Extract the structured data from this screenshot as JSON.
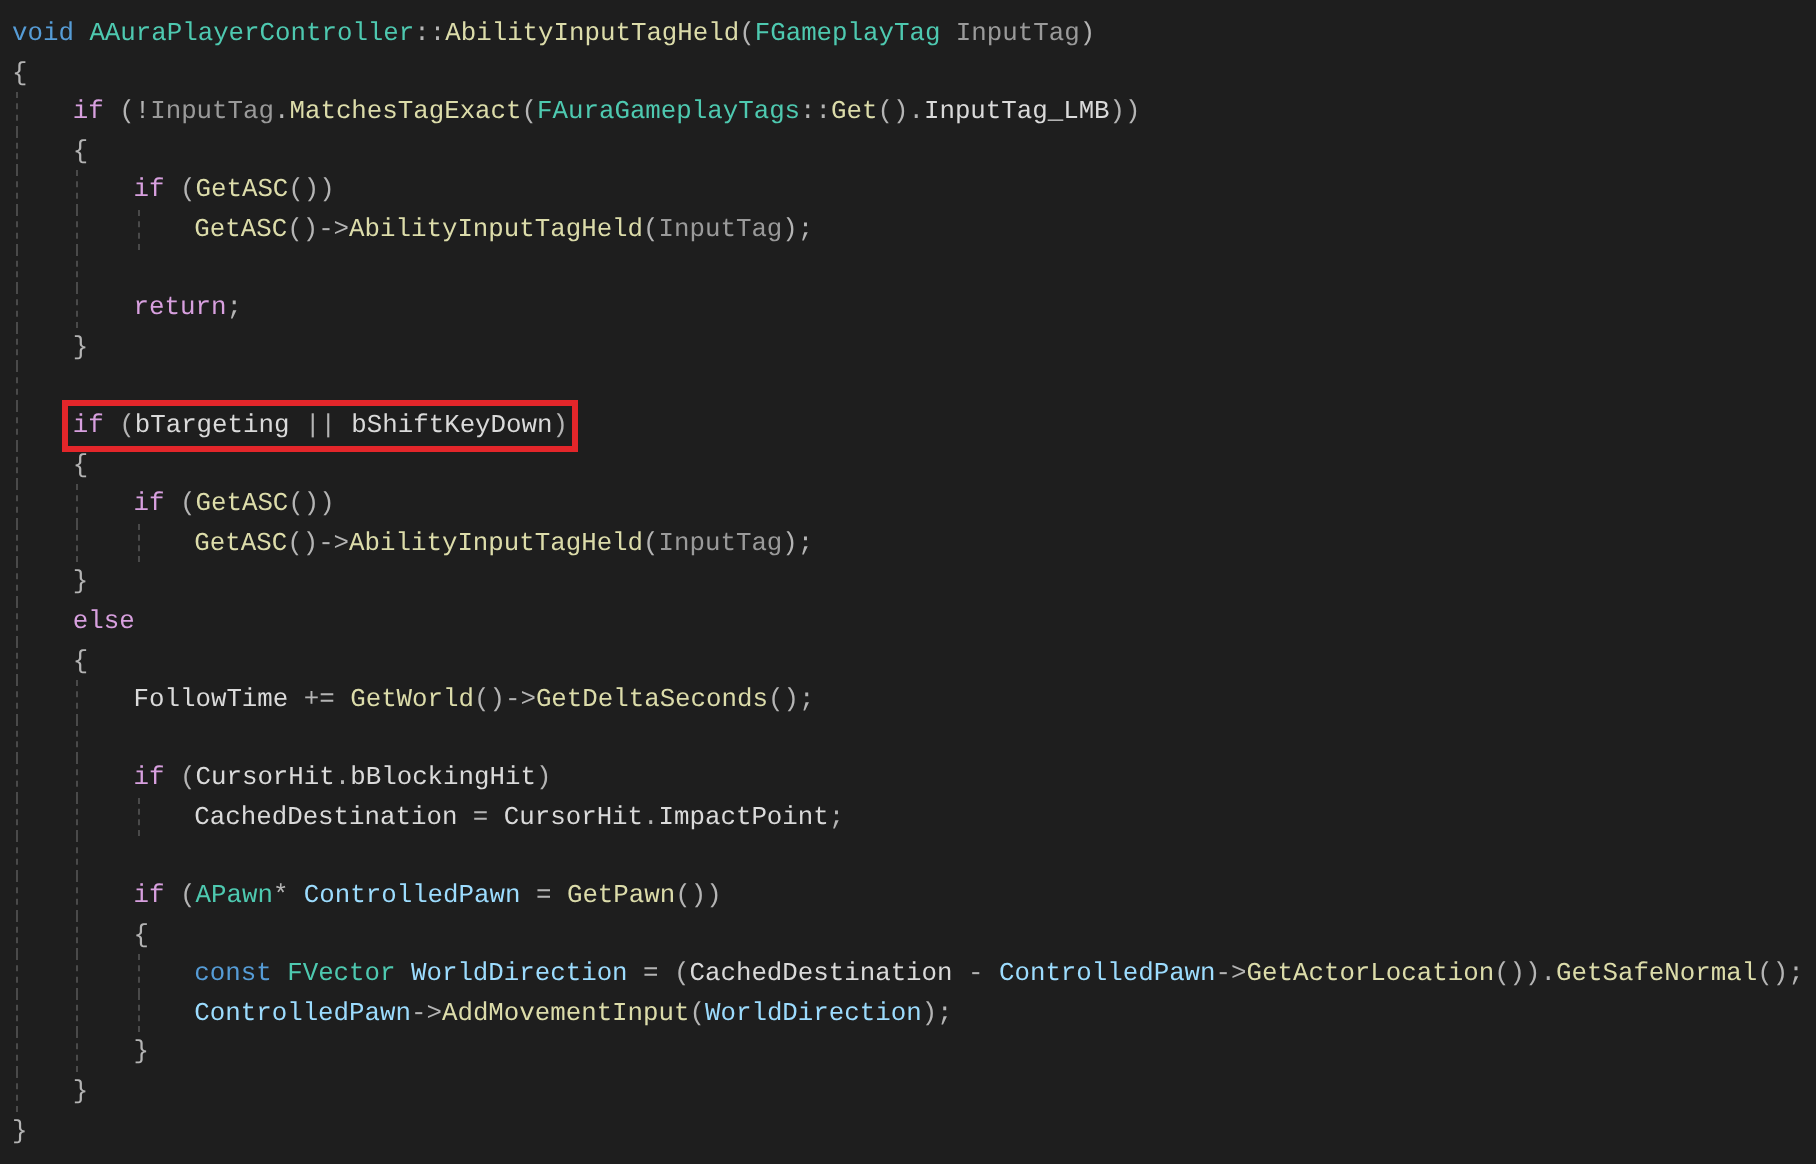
{
  "editor": {
    "code": [
      {
        "kind": "line",
        "boxed": false,
        "tokens": [
          {
            "kind": "kw",
            "text": "void "
          },
          {
            "kind": "type",
            "text": "AAuraPlayerController"
          },
          {
            "kind": "punct",
            "text": "::"
          },
          {
            "kind": "fn",
            "text": "AbilityInputTagHeld"
          },
          {
            "kind": "punct",
            "text": "("
          },
          {
            "kind": "type",
            "text": "FGameplayTag"
          },
          {
            "kind": "param",
            "text": " InputTag"
          },
          {
            "kind": "punct",
            "text": ")"
          }
        ]
      },
      {
        "kind": "line",
        "boxed": false,
        "tokens": [
          {
            "kind": "punct",
            "text": "{"
          }
        ]
      },
      {
        "kind": "block",
        "children": [
          {
            "kind": "line",
            "boxed": false,
            "tokens": [
              {
                "kind": "ctl",
                "text": "if"
              },
              {
                "kind": "punct",
                "text": " (!"
              },
              {
                "kind": "param",
                "text": "InputTag"
              },
              {
                "kind": "punct",
                "text": "."
              },
              {
                "kind": "fn",
                "text": "MatchesTagExact"
              },
              {
                "kind": "punct",
                "text": "("
              },
              {
                "kind": "type",
                "text": "FAuraGameplayTags"
              },
              {
                "kind": "punct",
                "text": "::"
              },
              {
                "kind": "fn",
                "text": "Get"
              },
              {
                "kind": "punct",
                "text": "()."
              },
              {
                "kind": "member",
                "text": "InputTag_LMB"
              },
              {
                "kind": "punct",
                "text": "))"
              }
            ]
          },
          {
            "kind": "line",
            "boxed": false,
            "tokens": [
              {
                "kind": "punct",
                "text": "{"
              }
            ]
          },
          {
            "kind": "block",
            "children": [
              {
                "kind": "line",
                "boxed": false,
                "tokens": [
                  {
                    "kind": "ctl",
                    "text": "if"
                  },
                  {
                    "kind": "punct",
                    "text": " ("
                  },
                  {
                    "kind": "fn",
                    "text": "GetASC"
                  },
                  {
                    "kind": "punct",
                    "text": "())"
                  }
                ]
              },
              {
                "kind": "block",
                "children": [
                  {
                    "kind": "line",
                    "boxed": false,
                    "tokens": [
                      {
                        "kind": "fn",
                        "text": "GetASC"
                      },
                      {
                        "kind": "punct",
                        "text": "()->"
                      },
                      {
                        "kind": "fn",
                        "text": "AbilityInputTagHeld"
                      },
                      {
                        "kind": "punct",
                        "text": "("
                      },
                      {
                        "kind": "param",
                        "text": "InputTag"
                      },
                      {
                        "kind": "punct",
                        "text": ");"
                      }
                    ]
                  }
                ]
              },
              {
                "kind": "blank"
              },
              {
                "kind": "line",
                "boxed": false,
                "tokens": [
                  {
                    "kind": "ctl",
                    "text": "return"
                  },
                  {
                    "kind": "punct",
                    "text": ";"
                  }
                ]
              }
            ]
          },
          {
            "kind": "line",
            "boxed": false,
            "tokens": [
              {
                "kind": "punct",
                "text": "}"
              }
            ]
          },
          {
            "kind": "blank"
          },
          {
            "kind": "line",
            "boxed": true,
            "tokens": [
              {
                "kind": "ctl",
                "text": "if"
              },
              {
                "kind": "punct",
                "text": " ("
              },
              {
                "kind": "member",
                "text": "bTargeting"
              },
              {
                "kind": "punct",
                "text": " || "
              },
              {
                "kind": "member",
                "text": "bShiftKeyDown"
              },
              {
                "kind": "punct",
                "text": ")"
              }
            ]
          },
          {
            "kind": "line",
            "boxed": false,
            "tokens": [
              {
                "kind": "punct",
                "text": "{"
              }
            ]
          },
          {
            "kind": "block",
            "children": [
              {
                "kind": "line",
                "boxed": false,
                "tokens": [
                  {
                    "kind": "ctl",
                    "text": "if"
                  },
                  {
                    "kind": "punct",
                    "text": " ("
                  },
                  {
                    "kind": "fn",
                    "text": "GetASC"
                  },
                  {
                    "kind": "punct",
                    "text": "())"
                  }
                ]
              },
              {
                "kind": "block",
                "children": [
                  {
                    "kind": "line",
                    "boxed": false,
                    "tokens": [
                      {
                        "kind": "fn",
                        "text": "GetASC"
                      },
                      {
                        "kind": "punct",
                        "text": "()->"
                      },
                      {
                        "kind": "fn",
                        "text": "AbilityInputTagHeld"
                      },
                      {
                        "kind": "punct",
                        "text": "("
                      },
                      {
                        "kind": "param",
                        "text": "InputTag"
                      },
                      {
                        "kind": "punct",
                        "text": ");"
                      }
                    ]
                  }
                ]
              }
            ]
          },
          {
            "kind": "line",
            "boxed": false,
            "tokens": [
              {
                "kind": "punct",
                "text": "}"
              }
            ]
          },
          {
            "kind": "line",
            "boxed": false,
            "tokens": [
              {
                "kind": "ctl",
                "text": "else"
              }
            ]
          },
          {
            "kind": "line",
            "boxed": false,
            "tokens": [
              {
                "kind": "punct",
                "text": "{"
              }
            ]
          },
          {
            "kind": "block",
            "children": [
              {
                "kind": "line",
                "boxed": false,
                "tokens": [
                  {
                    "kind": "member",
                    "text": "FollowTime"
                  },
                  {
                    "kind": "punct",
                    "text": " += "
                  },
                  {
                    "kind": "fn",
                    "text": "GetWorld"
                  },
                  {
                    "kind": "punct",
                    "text": "()->"
                  },
                  {
                    "kind": "fn",
                    "text": "GetDeltaSeconds"
                  },
                  {
                    "kind": "punct",
                    "text": "();"
                  }
                ]
              },
              {
                "kind": "blank"
              },
              {
                "kind": "line",
                "boxed": false,
                "tokens": [
                  {
                    "kind": "ctl",
                    "text": "if"
                  },
                  {
                    "kind": "punct",
                    "text": " ("
                  },
                  {
                    "kind": "member",
                    "text": "CursorHit"
                  },
                  {
                    "kind": "punct",
                    "text": "."
                  },
                  {
                    "kind": "member",
                    "text": "bBlockingHit"
                  },
                  {
                    "kind": "punct",
                    "text": ")"
                  }
                ]
              },
              {
                "kind": "block",
                "children": [
                  {
                    "kind": "line",
                    "boxed": false,
                    "tokens": [
                      {
                        "kind": "member",
                        "text": "CachedDestination"
                      },
                      {
                        "kind": "punct",
                        "text": " = "
                      },
                      {
                        "kind": "member",
                        "text": "CursorHit"
                      },
                      {
                        "kind": "punct",
                        "text": "."
                      },
                      {
                        "kind": "member",
                        "text": "ImpactPoint"
                      },
                      {
                        "kind": "punct",
                        "text": ";"
                      }
                    ]
                  }
                ]
              },
              {
                "kind": "blank"
              },
              {
                "kind": "line",
                "boxed": false,
                "tokens": [
                  {
                    "kind": "ctl",
                    "text": "if"
                  },
                  {
                    "kind": "punct",
                    "text": " ("
                  },
                  {
                    "kind": "type",
                    "text": "APawn"
                  },
                  {
                    "kind": "punct",
                    "text": "* "
                  },
                  {
                    "kind": "local",
                    "text": "ControlledPawn"
                  },
                  {
                    "kind": "punct",
                    "text": " = "
                  },
                  {
                    "kind": "fn",
                    "text": "GetPawn"
                  },
                  {
                    "kind": "punct",
                    "text": "())"
                  }
                ]
              },
              {
                "kind": "line",
                "boxed": false,
                "tokens": [
                  {
                    "kind": "punct",
                    "text": "{"
                  }
                ]
              },
              {
                "kind": "block",
                "children": [
                  {
                    "kind": "line",
                    "boxed": false,
                    "tokens": [
                      {
                        "kind": "kw",
                        "text": "const "
                      },
                      {
                        "kind": "type",
                        "text": "FVector"
                      },
                      {
                        "kind": "local",
                        "text": " WorldDirection"
                      },
                      {
                        "kind": "punct",
                        "text": " = ("
                      },
                      {
                        "kind": "member",
                        "text": "CachedDestination"
                      },
                      {
                        "kind": "punct",
                        "text": " - "
                      },
                      {
                        "kind": "local",
                        "text": "ControlledPawn"
                      },
                      {
                        "kind": "punct",
                        "text": "->"
                      },
                      {
                        "kind": "fn",
                        "text": "GetActorLocation"
                      },
                      {
                        "kind": "punct",
                        "text": "())."
                      },
                      {
                        "kind": "fn",
                        "text": "GetSafeNormal"
                      },
                      {
                        "kind": "punct",
                        "text": "();"
                      }
                    ]
                  },
                  {
                    "kind": "line",
                    "boxed": false,
                    "tokens": [
                      {
                        "kind": "local",
                        "text": "ControlledPawn"
                      },
                      {
                        "kind": "punct",
                        "text": "->"
                      },
                      {
                        "kind": "fn",
                        "text": "AddMovementInput"
                      },
                      {
                        "kind": "punct",
                        "text": "("
                      },
                      {
                        "kind": "local",
                        "text": "WorldDirection"
                      },
                      {
                        "kind": "punct",
                        "text": ");"
                      }
                    ]
                  }
                ]
              },
              {
                "kind": "line",
                "boxed": false,
                "tokens": [
                  {
                    "kind": "punct",
                    "text": "}"
                  }
                ]
              }
            ]
          },
          {
            "kind": "line",
            "boxed": false,
            "tokens": [
              {
                "kind": "punct",
                "text": "}"
              }
            ]
          }
        ]
      },
      {
        "kind": "line",
        "boxed": false,
        "tokens": [
          {
            "kind": "punct",
            "text": "}"
          }
        ]
      }
    ]
  }
}
